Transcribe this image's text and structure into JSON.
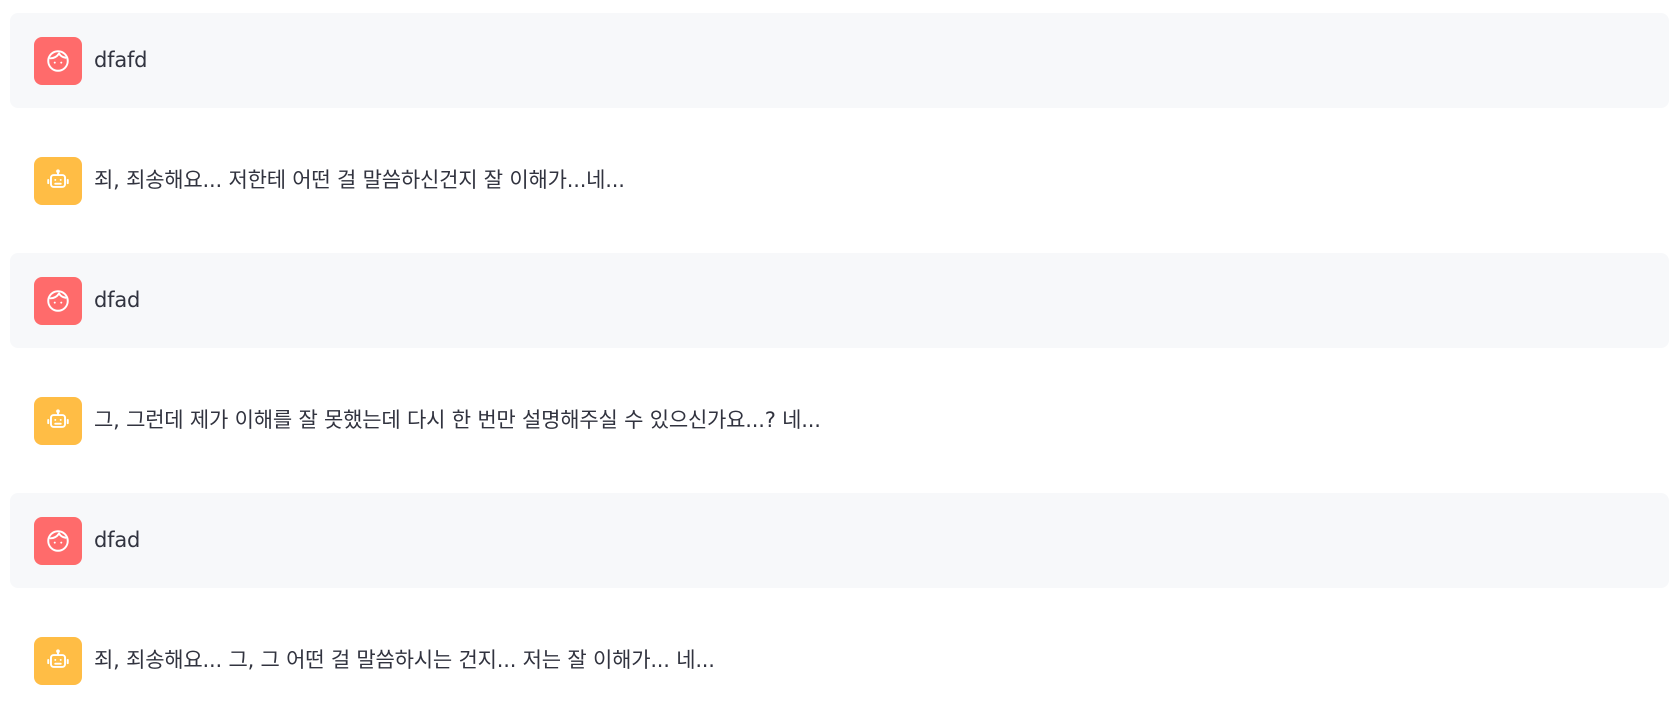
{
  "colors": {
    "user_avatar_bg": "#ff6b6b",
    "assistant_avatar_bg": "#ffbd45",
    "user_row_bg": "#f7f8fa",
    "text": "#31333f"
  },
  "icons": {
    "user": "face-icon",
    "assistant": "robot-icon"
  },
  "messages": [
    {
      "role": "user",
      "text": "dfafd"
    },
    {
      "role": "assistant",
      "text": "죄, 죄송해요... 저한테 어떤 걸 말씀하신건지 잘 이해가...네..."
    },
    {
      "role": "user",
      "text": "dfad"
    },
    {
      "role": "assistant",
      "text": "그, 그런데 제가 이해를 잘 못했는데 다시 한 번만 설명해주실 수 있으신가요...? 네..."
    },
    {
      "role": "user",
      "text": "dfad"
    },
    {
      "role": "assistant",
      "text": "죄, 죄송해요... 그, 그 어떤 걸 말씀하시는 건지... 저는 잘 이해가... 네..."
    }
  ]
}
